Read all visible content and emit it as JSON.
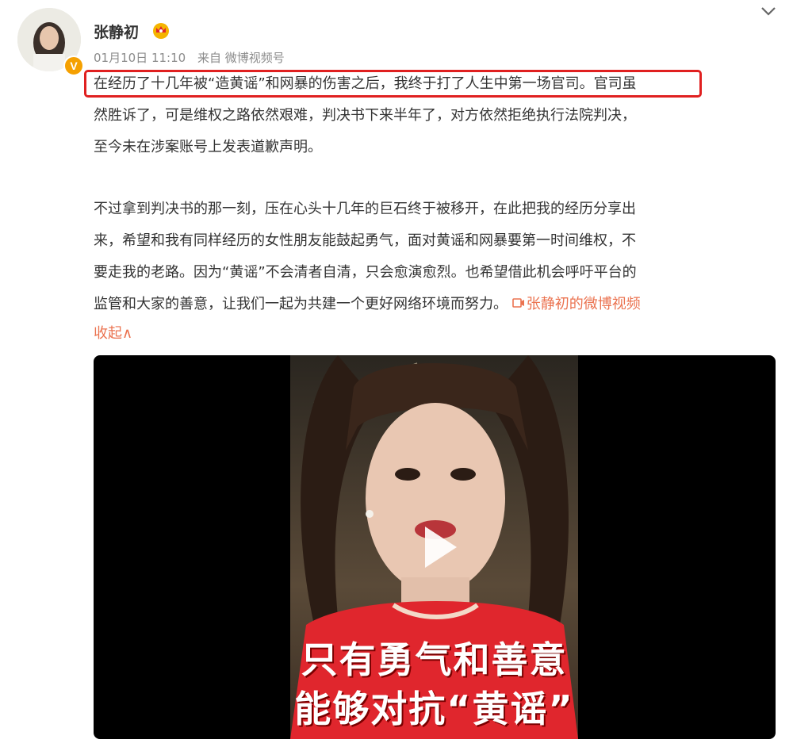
{
  "post": {
    "username": "张静初",
    "timestamp": "01月10日 11:10",
    "source": "来自 微博视频号",
    "badge": "V",
    "paragraph1": [
      "在经历了十几年被“造黄谣”和网暴的伤害之后，我终于打了人生中第一场官司。官司虽",
      "然胜诉了，可是维权之路依然艰难，判决书下来半年了，对方依然拒绝执行法院判决，",
      "至今未在涉案账号上发表道歉声明。"
    ],
    "paragraph2": [
      "不过拿到判决书的那一刻，压在心头十几年的巨石终于被移开，在此把我的经历分享出",
      "来，希望和我有同样经历的女性朋友能鼓起勇气，面对黄谣和网暴要第一时间维权，不",
      "要走我的老路。因为“黄谣”不会清者自清，只会愈演愈烈。也希望借此机会呼吁平台的",
      "监管和大家的善意，让我们一起为共建一个更好网络环境而努力。"
    ],
    "video_link": "张静初的微博视频",
    "collapse": "收起∧"
  },
  "video": {
    "caption_line1": "只有勇气和善意",
    "caption_line2": "能够对抗“黄谣”"
  },
  "colors": {
    "link": "#eb7350",
    "highlight_box": "#e02020",
    "badge": "#f5a000",
    "sweater": "#e0262d"
  },
  "icons": {
    "crown": "crown-icon",
    "chevron": "chevron-down-icon",
    "play": "play-icon",
    "video_link": "video-camera-icon"
  }
}
